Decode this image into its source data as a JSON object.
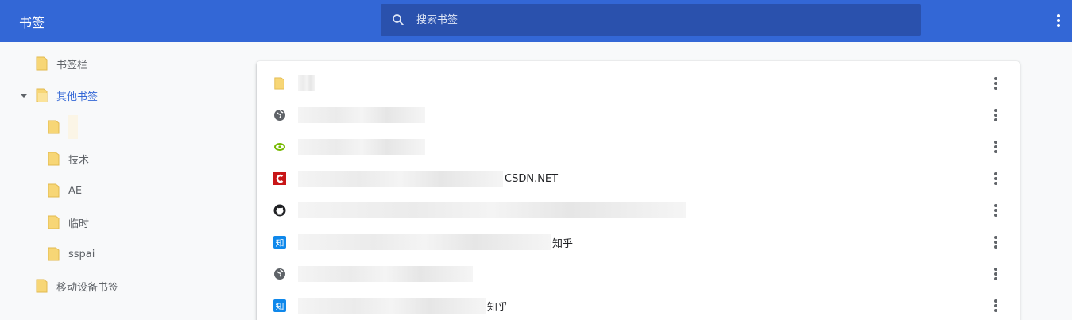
{
  "header": {
    "title": "书签",
    "search_placeholder": "搜索书签",
    "more_icon": "more-vert-icon"
  },
  "sidebar": {
    "items": [
      {
        "label": "书签栏",
        "icon": "folder-icon"
      },
      {
        "label": "其他书签",
        "icon": "folder-open-icon",
        "active": true
      },
      {
        "label": "",
        "icon": "folder-icon"
      },
      {
        "label": "技术",
        "icon": "folder-icon"
      },
      {
        "label": "AE",
        "icon": "folder-icon"
      },
      {
        "label": "临时",
        "icon": "folder-icon"
      },
      {
        "label": "sspai",
        "icon": "folder-icon"
      },
      {
        "label": "移动设备书签",
        "icon": "folder-icon"
      }
    ]
  },
  "list": {
    "rows": [
      {
        "icon": "folder-icon",
        "suffix": ""
      },
      {
        "icon": "globe-icon",
        "suffix": ""
      },
      {
        "icon": "nvidia-icon",
        "suffix": ""
      },
      {
        "icon": "csdn-icon",
        "suffix": "CSDN.NET"
      },
      {
        "icon": "github-icon",
        "suffix": ""
      },
      {
        "icon": "zhihu-icon",
        "suffix": "知乎"
      },
      {
        "icon": "globe-icon",
        "suffix": ""
      },
      {
        "icon": "zhihu-icon",
        "suffix": "知乎"
      }
    ]
  },
  "colors": {
    "header": "#3367d6",
    "search": "#2a51ad",
    "folder": "#f7d676",
    "csdn": "#c81618",
    "zhihu": "#0f88eb"
  }
}
